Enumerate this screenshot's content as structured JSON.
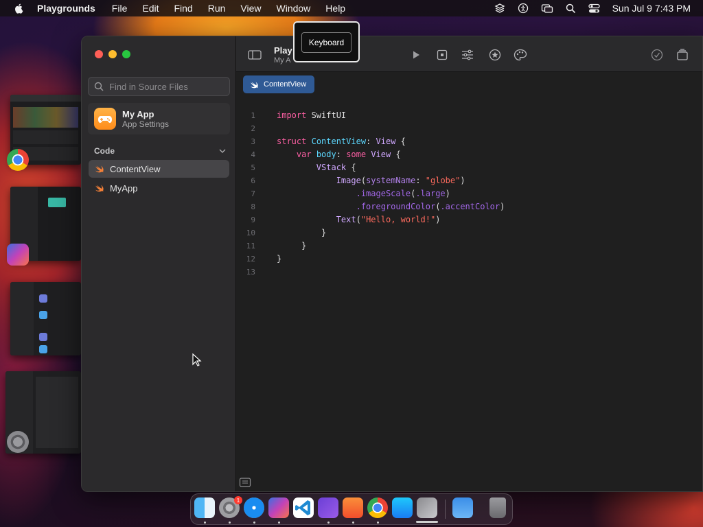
{
  "menubar": {
    "app_name": "Playgrounds",
    "items": [
      "File",
      "Edit",
      "Find",
      "Run",
      "View",
      "Window",
      "Help"
    ],
    "datetime": "Sun Jul 9  7:43 PM",
    "status_icons": [
      "layers-icon",
      "accessibility-icon",
      "screen-mirroring-icon",
      "spotlight-search-icon",
      "control-center-icon"
    ]
  },
  "tooltip": {
    "label": "Keyboard"
  },
  "sidebar": {
    "search_placeholder": "Find in Source Files",
    "app_settings": {
      "title": "My App",
      "subtitle": "App Settings"
    },
    "section_title": "Code",
    "files": [
      {
        "name": "ContentView",
        "selected": true
      },
      {
        "name": "MyApp",
        "selected": false
      }
    ]
  },
  "toolbar": {
    "title": "Play",
    "subtitle": "My A"
  },
  "editor": {
    "tab": "ContentView",
    "line_numbers": [
      "1",
      "2",
      "3",
      "4",
      "5",
      "6",
      "7",
      "8",
      "9",
      "10",
      "11",
      "12",
      "13"
    ]
  },
  "code": {
    "l1_kw": "import",
    "l1_rest": " SwiftUI",
    "l3_kw": "struct",
    "l3_name": "ContentView",
    "l3_colon": ": ",
    "l3_type": "View",
    "l3_brace": " {",
    "l4_kw": "var",
    "l4_name": "body",
    "l4_colon": ": ",
    "l4_kw2": "some",
    "l4_type": "View",
    "l4_brace": " {",
    "l5_type": "VStack",
    "l5_brace": " {",
    "l6_fn": "Image",
    "l6_open": "(",
    "l6_arg": "systemName",
    "l6_colon": ": ",
    "l6_str": "\"globe\"",
    "l6_close": ")",
    "l7_mod": ".imageScale",
    "l7_open": "(",
    "l7_val": ".large",
    "l7_close": ")",
    "l8_mod": ".foregroundColor",
    "l8_open": "(",
    "l8_val": ".accentColor",
    "l8_close": ")",
    "l9_fn": "Text",
    "l9_open": "(",
    "l9_str": "\"Hello, world!\"",
    "l9_close": ")",
    "l10": "}",
    "l11": "}",
    "l12": "}"
  },
  "colors": {
    "keyword": "#fc5fa3",
    "type": "#5dd8ff",
    "string": "#fc6a5d",
    "tab_accent": "#2f5a95"
  },
  "dock": {
    "apps": [
      "finder-icon",
      "system-settings-icon",
      "safari-icon",
      "shortcuts-icon",
      "vscode-icon",
      "visual-studio-icon",
      "swift-playgrounds-icon",
      "chrome-icon",
      "app-store-icon",
      "launchpad-icon",
      "weather-icon",
      "trash-icon"
    ],
    "settings_badge": "1"
  }
}
